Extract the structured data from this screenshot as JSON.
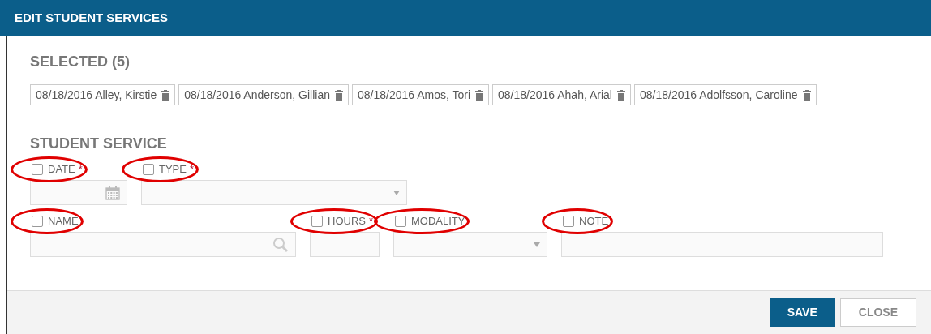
{
  "window": {
    "title": "EDIT STUDENT SERVICES"
  },
  "selected": {
    "heading": "SELECTED (5)",
    "items": [
      {
        "label": "08/18/2016 Alley, Kirstie"
      },
      {
        "label": "08/18/2016 Anderson, Gillian"
      },
      {
        "label": "08/18/2016 Amos, Tori"
      },
      {
        "label": "08/18/2016 Ahah, Arial"
      },
      {
        "label": "08/18/2016 Adolfsson, Caroline"
      }
    ]
  },
  "student_service": {
    "heading": "STUDENT SERVICE",
    "rows": [
      [
        {
          "label": "DATE",
          "required_mark": "*",
          "checked": false,
          "circled": true,
          "kind": "date"
        },
        {
          "label": "TYPE",
          "required_mark": "*",
          "checked": false,
          "circled": true,
          "kind": "select"
        }
      ],
      [
        {
          "label": "NAME",
          "checked": false,
          "circled": true,
          "kind": "search"
        },
        {
          "label": "HOURS",
          "required_mark": "*",
          "checked": false,
          "circled": true,
          "kind": "text"
        },
        {
          "label": "MODALITY",
          "checked": false,
          "circled": true,
          "kind": "select"
        },
        {
          "label": "NOTE",
          "checked": false,
          "circled": true,
          "kind": "text"
        }
      ]
    ]
  },
  "buttons": [
    {
      "label": "SAVE",
      "kind": "primary"
    },
    {
      "label": "CLOSE",
      "kind": "secondary"
    }
  ]
}
